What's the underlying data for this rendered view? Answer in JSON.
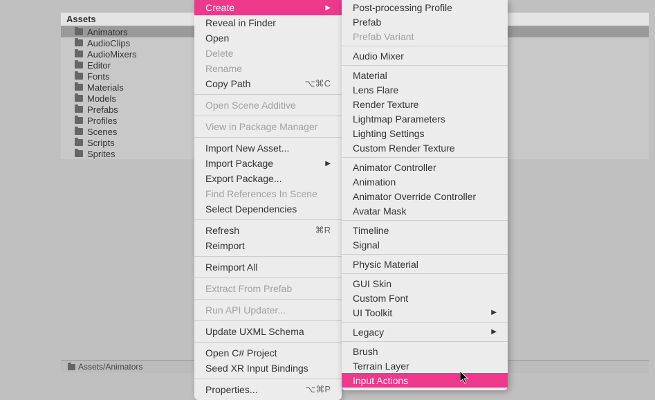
{
  "panel": {
    "header": "Assets",
    "items": [
      {
        "label": "Animators",
        "selected": true
      },
      {
        "label": "AudioClips",
        "selected": false
      },
      {
        "label": "AudioMixers",
        "selected": false
      },
      {
        "label": "Editor",
        "selected": false
      },
      {
        "label": "Fonts",
        "selected": false
      },
      {
        "label": "Materials",
        "selected": false
      },
      {
        "label": "Models",
        "selected": false
      },
      {
        "label": "Prefabs",
        "selected": false
      },
      {
        "label": "Profiles",
        "selected": false
      },
      {
        "label": "Scenes",
        "selected": false
      },
      {
        "label": "Scripts",
        "selected": false
      },
      {
        "label": "Sprites",
        "selected": false
      }
    ]
  },
  "breadcrumb": "Assets/Animators",
  "context_menu": [
    {
      "label": "Create",
      "type": "submenu",
      "highlight": true
    },
    {
      "label": "Reveal in Finder"
    },
    {
      "label": "Open"
    },
    {
      "label": "Delete",
      "disabled": true
    },
    {
      "label": "Rename",
      "disabled": true
    },
    {
      "label": "Copy Path",
      "shortcut": "⌥⌘C"
    },
    {
      "type": "divider"
    },
    {
      "label": "Open Scene Additive",
      "disabled": true
    },
    {
      "type": "divider"
    },
    {
      "label": "View in Package Manager",
      "disabled": true
    },
    {
      "type": "divider"
    },
    {
      "label": "Import New Asset..."
    },
    {
      "label": "Import Package",
      "type": "submenu"
    },
    {
      "label": "Export Package..."
    },
    {
      "label": "Find References In Scene",
      "disabled": true
    },
    {
      "label": "Select Dependencies"
    },
    {
      "type": "divider"
    },
    {
      "label": "Refresh",
      "shortcut": "⌘R"
    },
    {
      "label": "Reimport"
    },
    {
      "type": "divider"
    },
    {
      "label": "Reimport All"
    },
    {
      "type": "divider"
    },
    {
      "label": "Extract From Prefab",
      "disabled": true
    },
    {
      "type": "divider"
    },
    {
      "label": "Run API Updater...",
      "disabled": true
    },
    {
      "type": "divider"
    },
    {
      "label": "Update UXML Schema"
    },
    {
      "type": "divider"
    },
    {
      "label": "Open C# Project"
    },
    {
      "label": "Seed XR Input Bindings"
    },
    {
      "type": "divider"
    },
    {
      "label": "Properties...",
      "shortcut": "⌥⌘P"
    }
  ],
  "submenu": [
    {
      "label": "Post-processing Profile"
    },
    {
      "label": "Prefab"
    },
    {
      "label": "Prefab Variant",
      "disabled": true
    },
    {
      "type": "divider"
    },
    {
      "label": "Audio Mixer"
    },
    {
      "type": "divider"
    },
    {
      "label": "Material"
    },
    {
      "label": "Lens Flare"
    },
    {
      "label": "Render Texture"
    },
    {
      "label": "Lightmap Parameters"
    },
    {
      "label": "Lighting Settings"
    },
    {
      "label": "Custom Render Texture"
    },
    {
      "type": "divider"
    },
    {
      "label": "Animator Controller"
    },
    {
      "label": "Animation"
    },
    {
      "label": "Animator Override Controller"
    },
    {
      "label": "Avatar Mask"
    },
    {
      "type": "divider"
    },
    {
      "label": "Timeline"
    },
    {
      "label": "Signal"
    },
    {
      "type": "divider"
    },
    {
      "label": "Physic Material"
    },
    {
      "type": "divider"
    },
    {
      "label": "GUI Skin"
    },
    {
      "label": "Custom Font"
    },
    {
      "label": "UI Toolkit",
      "type": "submenu"
    },
    {
      "type": "divider"
    },
    {
      "label": "Legacy",
      "type": "submenu"
    },
    {
      "type": "divider"
    },
    {
      "label": "Brush"
    },
    {
      "label": "Terrain Layer"
    },
    {
      "label": "Input Actions",
      "highlight": true
    }
  ]
}
